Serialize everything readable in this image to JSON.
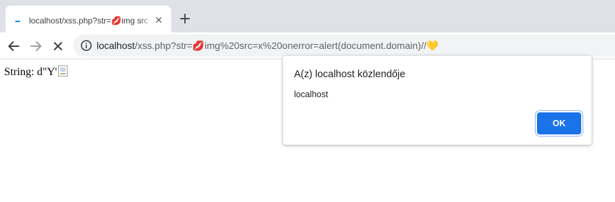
{
  "browser": {
    "tab": {
      "title": "localhost/xss.php?str=💋img src"
    },
    "url": {
      "host": "localhost",
      "path": "/xss.php?str=💋img%20src=x%20onerror=alert(document.domain)//💛"
    },
    "icons": {
      "back": "arrow-left-icon",
      "forward": "arrow-right-icon",
      "stop": "close-icon",
      "info": "info-icon",
      "new_tab": "plus-icon",
      "close_tab": "close-icon",
      "loading": "loading-spinner-icon"
    }
  },
  "page": {
    "text": "String: d\"Y'"
  },
  "dialog": {
    "title": "A(z) localhost közlendője",
    "message": "localhost",
    "ok_label": "OK"
  },
  "colors": {
    "accent": "#1a73e8",
    "tabstrip": "#dee1e6",
    "omnibox": "#f1f3f4"
  }
}
